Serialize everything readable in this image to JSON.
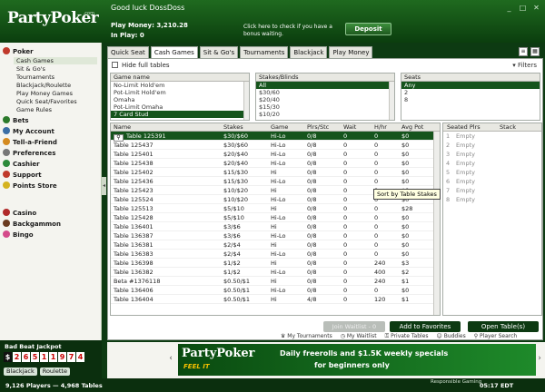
{
  "header": {
    "logo_text": "PartyPoker",
    "logo_suffix": ".com",
    "greeting": "Good luck DossDoss",
    "play_money_label": "Play Money: 3,210.28",
    "in_play_label": "In Play: 0",
    "bonus_text": "Click here to check if you have a bonus waiting.",
    "deposit_label": "Deposit",
    "window_controls": [
      "_",
      "□",
      "✕"
    ]
  },
  "nav": {
    "poker": "Poker",
    "poker_items": [
      "Cash Games",
      "Sit & Go's",
      "Tournaments",
      "Blackjack/Roulette",
      "Play Money Games",
      "Quick Seat/Favorites",
      "Game Rules"
    ],
    "bets": "Bets",
    "my_account": "My Account",
    "tell_a_friend": "Tell-a-Friend",
    "preferences": "Preferences",
    "cashier": "Cashier",
    "support": "Support",
    "points_store": "Points Store",
    "casino": "Casino",
    "backgammon": "Backgammon",
    "bingo": "Bingo"
  },
  "tabs": [
    "Quick Seat",
    "Cash Games",
    "Sit & Go's",
    "Tournaments",
    "Blackjack",
    "Play Money"
  ],
  "active_tab": "Cash Games",
  "hide_full_label": "Hide full tables",
  "filters_label": "Filters",
  "game_filter": {
    "header": "Game name",
    "items": [
      "No-Limit Hold'em",
      "Pot-Limit Hold'em",
      "Omaha",
      "Pot-Limit Omaha",
      "7 Card Stud"
    ],
    "selected": "7 Card Stud"
  },
  "stakes_filter": {
    "header": "Stakes/Blinds",
    "items": [
      "All",
      "$30/60",
      "$20/40",
      "$15/30",
      "$10/20"
    ],
    "selected": "All"
  },
  "seats_filter": {
    "header": "Seats",
    "items": [
      "Any",
      "2",
      "8"
    ],
    "selected": "Any"
  },
  "grid": {
    "columns": [
      "Name",
      "Stakes",
      "Game",
      "Plrs/Stc",
      "Wait",
      "H/hr",
      "Avg Pot"
    ],
    "rows": [
      [
        "Table 125391",
        "$30/$60",
        "Hi-Lo",
        "0/8",
        "0",
        "0",
        "$0"
      ],
      [
        "Table 125437",
        "$30/$60",
        "Hi-Lo",
        "0/8",
        "0",
        "0",
        "$0"
      ],
      [
        "Table 125401",
        "$20/$40",
        "Hi-Lo",
        "0/8",
        "0",
        "0",
        "$0"
      ],
      [
        "Table 125438",
        "$20/$40",
        "Hi-Lo",
        "0/8",
        "0",
        "0",
        "$0"
      ],
      [
        "Table 125402",
        "$15/$30",
        "Hi",
        "0/8",
        "0",
        "0",
        "$0"
      ],
      [
        "Table 125436",
        "$15/$30",
        "Hi-Lo",
        "0/8",
        "0",
        "0",
        "$0"
      ],
      [
        "Table 125423",
        "$10/$20",
        "Hi",
        "0/8",
        "0",
        "0",
        "$0"
      ],
      [
        "Table 125524",
        "$10/$20",
        "Hi-Lo",
        "0/8",
        "0",
        "0",
        "$0"
      ],
      [
        "Table 125513",
        "$5/$10",
        "Hi",
        "0/8",
        "0",
        "0",
        "$28"
      ],
      [
        "Table 125428",
        "$5/$10",
        "Hi-Lo",
        "0/8",
        "0",
        "0",
        "$0"
      ],
      [
        "Table 136401",
        "$3/$6",
        "Hi",
        "0/8",
        "0",
        "0",
        "$0"
      ],
      [
        "Table 136387",
        "$3/$6",
        "Hi-Lo",
        "0/8",
        "0",
        "0",
        "$0"
      ],
      [
        "Table 136381",
        "$2/$4",
        "Hi",
        "0/8",
        "0",
        "0",
        "$0"
      ],
      [
        "Table 136383",
        "$2/$4",
        "Hi-Lo",
        "0/8",
        "0",
        "0",
        "$0"
      ],
      [
        "Table 136398",
        "$1/$2",
        "Hi",
        "0/8",
        "0",
        "240",
        "$3"
      ],
      [
        "Table 136382",
        "$1/$2",
        "Hi-Lo",
        "0/8",
        "0",
        "400",
        "$2"
      ],
      [
        "Beta #1376118",
        "$0.50/$1",
        "Hi",
        "0/8",
        "0",
        "240",
        "$1"
      ],
      [
        "Table 136406",
        "$0.50/$1",
        "Hi-Lo",
        "0/8",
        "0",
        "0",
        "$0"
      ],
      [
        "Table 136404",
        "$0.50/$1",
        "Hi",
        "4/8",
        "0",
        "120",
        "$1"
      ]
    ],
    "tooltip": "Sort by Table Stakes"
  },
  "seats": {
    "columns": [
      "Seated Plrs",
      "Stack"
    ],
    "rows": [
      [
        "1",
        "Empty"
      ],
      [
        "2",
        "Empty"
      ],
      [
        "3",
        "Empty"
      ],
      [
        "4",
        "Empty"
      ],
      [
        "5",
        "Empty"
      ],
      [
        "6",
        "Empty"
      ],
      [
        "7",
        "Empty"
      ],
      [
        "8",
        "Empty"
      ]
    ]
  },
  "buttons": {
    "join_waitlist": "Join Waitlist - 0",
    "add_favorites": "Add to Favorites",
    "open_tables": "Open Table(s)"
  },
  "bottom_links": [
    "My Tournaments",
    "My Waitlist",
    "Private Tables",
    "Buddies",
    "Player Search"
  ],
  "jackpot": {
    "title": "Bad Beat Jackpot",
    "digits": [
      "$",
      "2",
      "6",
      "5",
      "1",
      "1",
      "9",
      "7",
      "4"
    ],
    "tabs": [
      "Blackjack",
      "Roulette"
    ]
  },
  "banner": {
    "logo": "PartyPoker",
    "tagline": "FEEL IT",
    "line1": "Daily freerolls and $1.5K weekly specials",
    "line2": "for beginners only"
  },
  "status": {
    "counts": "9,126 Players — 4,968 Tables",
    "responsible": "Responsible Gaming",
    "time": "05:17 EDT"
  },
  "colors": {
    "brand_green": "#15541c",
    "header_green": "#1f6a1f",
    "jackpot_red": "#c80000",
    "banner_yellow": "#f7c000"
  }
}
